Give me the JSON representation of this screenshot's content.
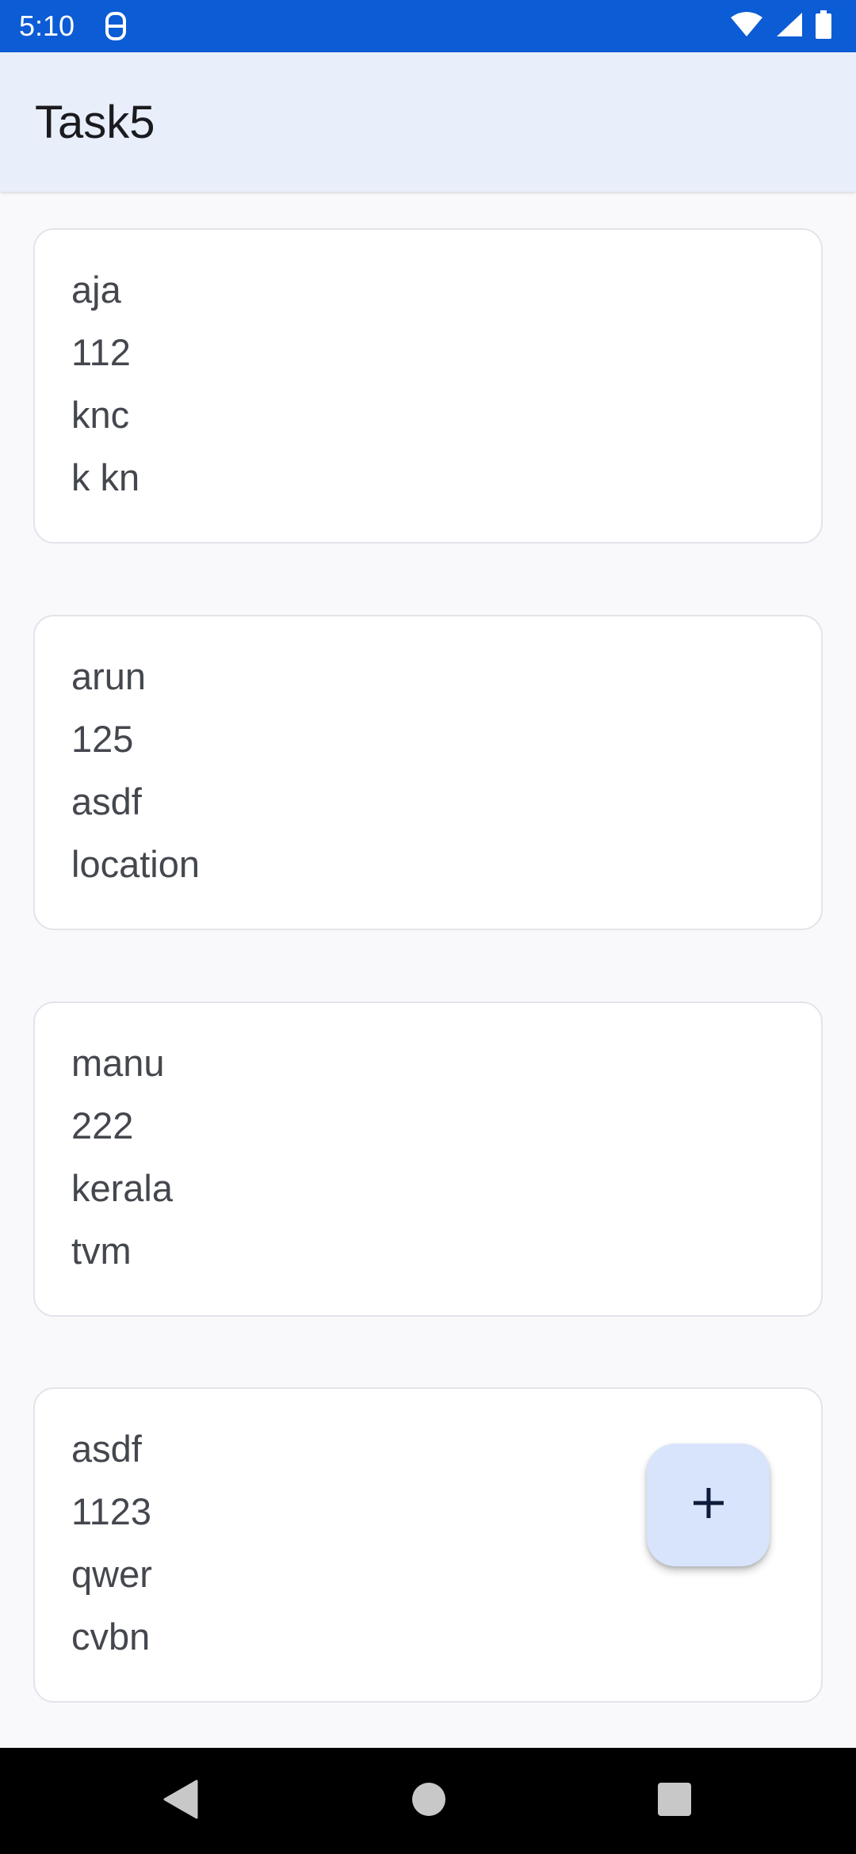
{
  "status_bar": {
    "time": "5:10",
    "background_color": "#0b5cd5",
    "icons": [
      "notification-icon",
      "wifi-icon",
      "signal-icon",
      "battery-icon"
    ]
  },
  "app_bar": {
    "title": "Task5",
    "background_color": "#e8eefa"
  },
  "records": [
    {
      "lines": [
        "aja",
        "112",
        "knc",
        "k kn"
      ]
    },
    {
      "lines": [
        "arun",
        "125",
        "asdf",
        "location"
      ]
    },
    {
      "lines": [
        "manu",
        "222",
        "kerala",
        "tvm"
      ]
    },
    {
      "lines": [
        "asdf",
        "1123",
        "qwer",
        "cvbn"
      ]
    }
  ],
  "fab": {
    "icon": "plus-icon",
    "background_color": "#d8e4fb"
  },
  "nav_bar": {
    "buttons": [
      "back-icon",
      "home-icon",
      "recents-icon"
    ]
  }
}
